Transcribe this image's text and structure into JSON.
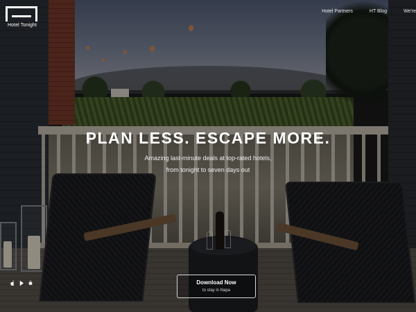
{
  "brand": {
    "name": "Hotel Tonight"
  },
  "nav": {
    "items": [
      "Hotel Partners",
      "HT Blog",
      "We're"
    ]
  },
  "hero": {
    "headline_part1": "PLAN LESS.",
    "headline_part2": "ESCAPE MORE.",
    "subline1": "Amazing last-minute deals at top-rated hotels,",
    "subline2": "from tonight to seven days out"
  },
  "cta": {
    "label": "Download Now",
    "sublabel": "to stay in Napa"
  },
  "store_icons": [
    "apple-icon",
    "google-play-icon",
    "android-icon"
  ],
  "colors": {
    "overlay_text": "#ffffff",
    "cta_border": "#d8d8d8"
  }
}
